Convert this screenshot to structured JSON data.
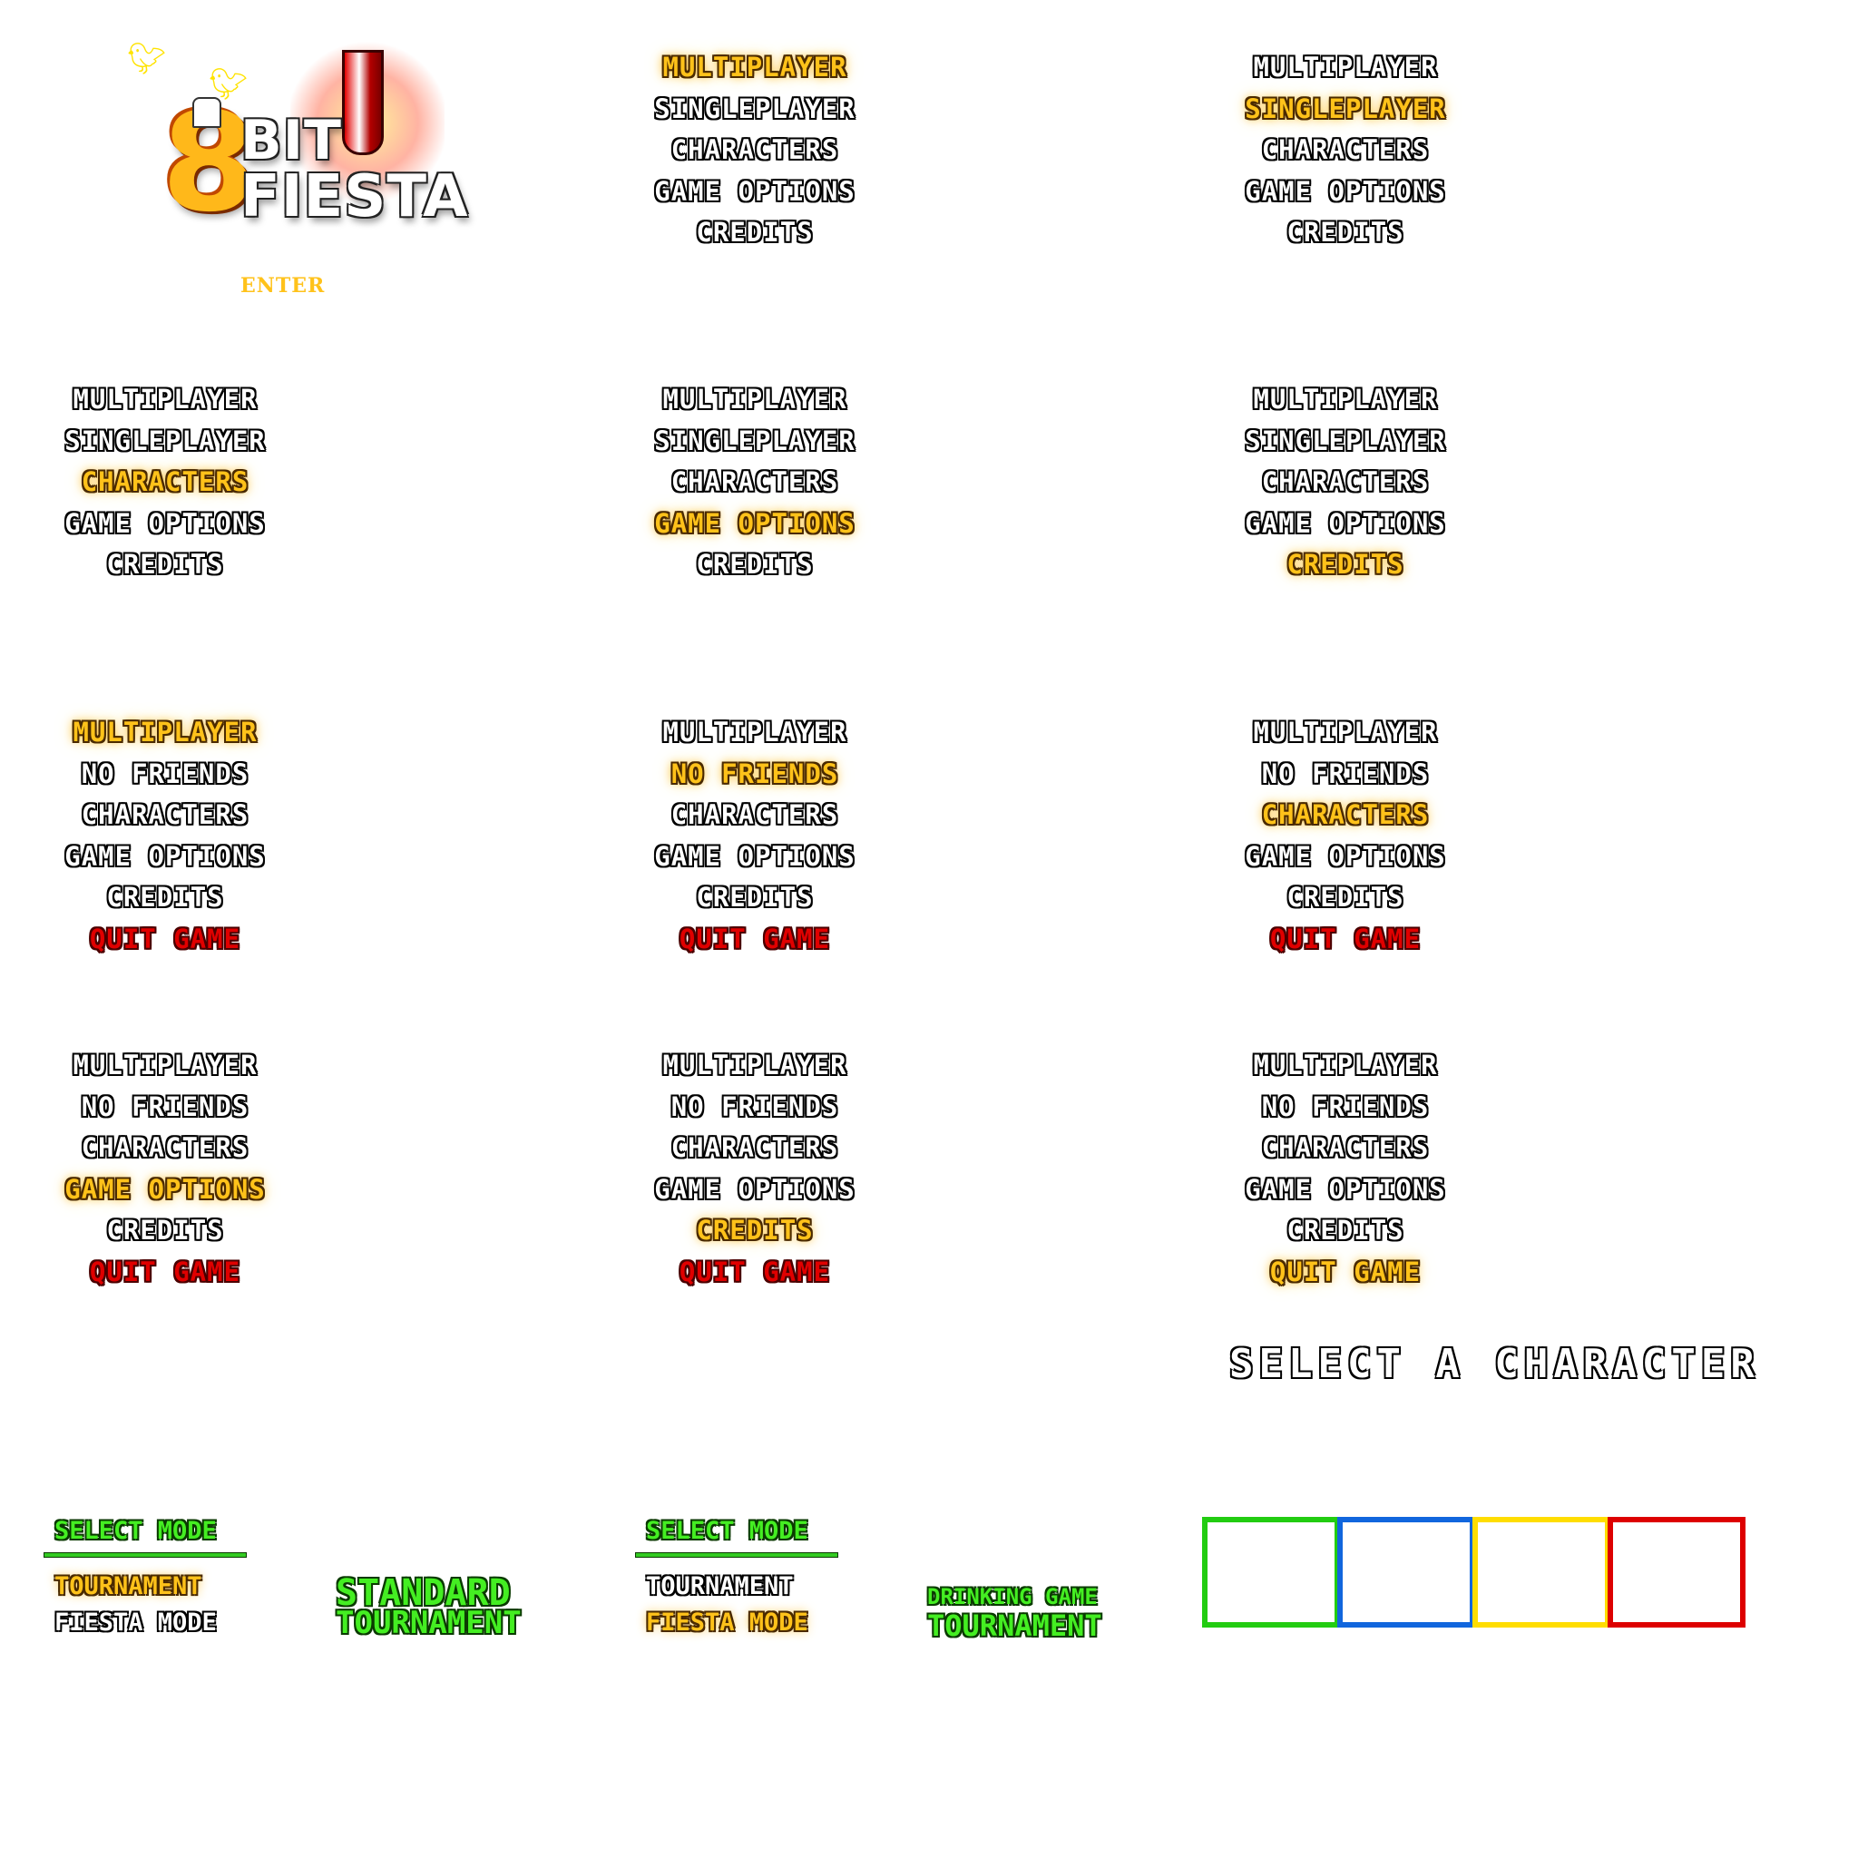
{
  "colors": {
    "selected": "#ffc21a",
    "quit": "#e00000",
    "green": "#44ee22"
  },
  "logo": {
    "number": "8",
    "word1": "BIT",
    "word2": "FIESTA",
    "enter": "ENTER"
  },
  "menus": [
    [
      "MULTIPLAYER",
      "SINGLEPLAYER",
      "CHARACTERS",
      "GAME OPTIONS",
      "CREDITS"
    ],
    [
      "MULTIPLAYER",
      "SINGLEPLAYER",
      "CHARACTERS",
      "GAME OPTIONS",
      "CREDITS"
    ],
    [
      "MULTIPLAYER",
      "SINGLEPLAYER",
      "CHARACTERS",
      "GAME OPTIONS",
      "CREDITS"
    ],
    [
      "MULTIPLAYER",
      "SINGLEPLAYER",
      "CHARACTERS",
      "GAME OPTIONS",
      "CREDITS"
    ],
    [
      "MULTIPLAYER",
      "SINGLEPLAYER",
      "CHARACTERS",
      "GAME OPTIONS",
      "CREDITS"
    ],
    [
      "MULTIPLAYER",
      "NO FRIENDS",
      "CHARACTERS",
      "GAME OPTIONS",
      "CREDITS",
      "QUIT GAME"
    ],
    [
      "MULTIPLAYER",
      "NO FRIENDS",
      "CHARACTERS",
      "GAME OPTIONS",
      "CREDITS",
      "QUIT GAME"
    ],
    [
      "MULTIPLAYER",
      "NO FRIENDS",
      "CHARACTERS",
      "GAME OPTIONS",
      "CREDITS",
      "QUIT GAME"
    ],
    [
      "MULTIPLAYER",
      "NO FRIENDS",
      "CHARACTERS",
      "GAME OPTIONS",
      "CREDITS",
      "QUIT GAME"
    ],
    [
      "MULTIPLAYER",
      "NO FRIENDS",
      "CHARACTERS",
      "GAME OPTIONS",
      "CREDITS",
      "QUIT GAME"
    ],
    [
      "MULTIPLAYER",
      "NO FRIENDS",
      "CHARACTERS",
      "GAME OPTIONS",
      "CREDITS",
      "QUIT GAME"
    ]
  ],
  "menu_selected": [
    0,
    1,
    2,
    3,
    4,
    0,
    1,
    2,
    3,
    4,
    5
  ],
  "select_character": "SELECT A CHARACTER",
  "mode_panels": [
    {
      "title": "SELECT MODE",
      "items": [
        "TOURNAMENT",
        "FIESTA MODE"
      ],
      "selected": 0
    },
    {
      "title": "SELECT MODE",
      "items": [
        "TOURNAMENT",
        "FIESTA MODE"
      ],
      "selected": 1
    }
  ],
  "mode_titles": {
    "standard_line1": "STANDARD",
    "standard_line2": "TOURNAMENT",
    "drinking_line1": "DRINKING GAME",
    "drinking_line2": "TOURNAMENT"
  },
  "player_slots": [
    {
      "color": "#22cc11"
    },
    {
      "color": "#1166dd"
    },
    {
      "color": "#ffdd00"
    },
    {
      "color": "#dd0000"
    }
  ]
}
